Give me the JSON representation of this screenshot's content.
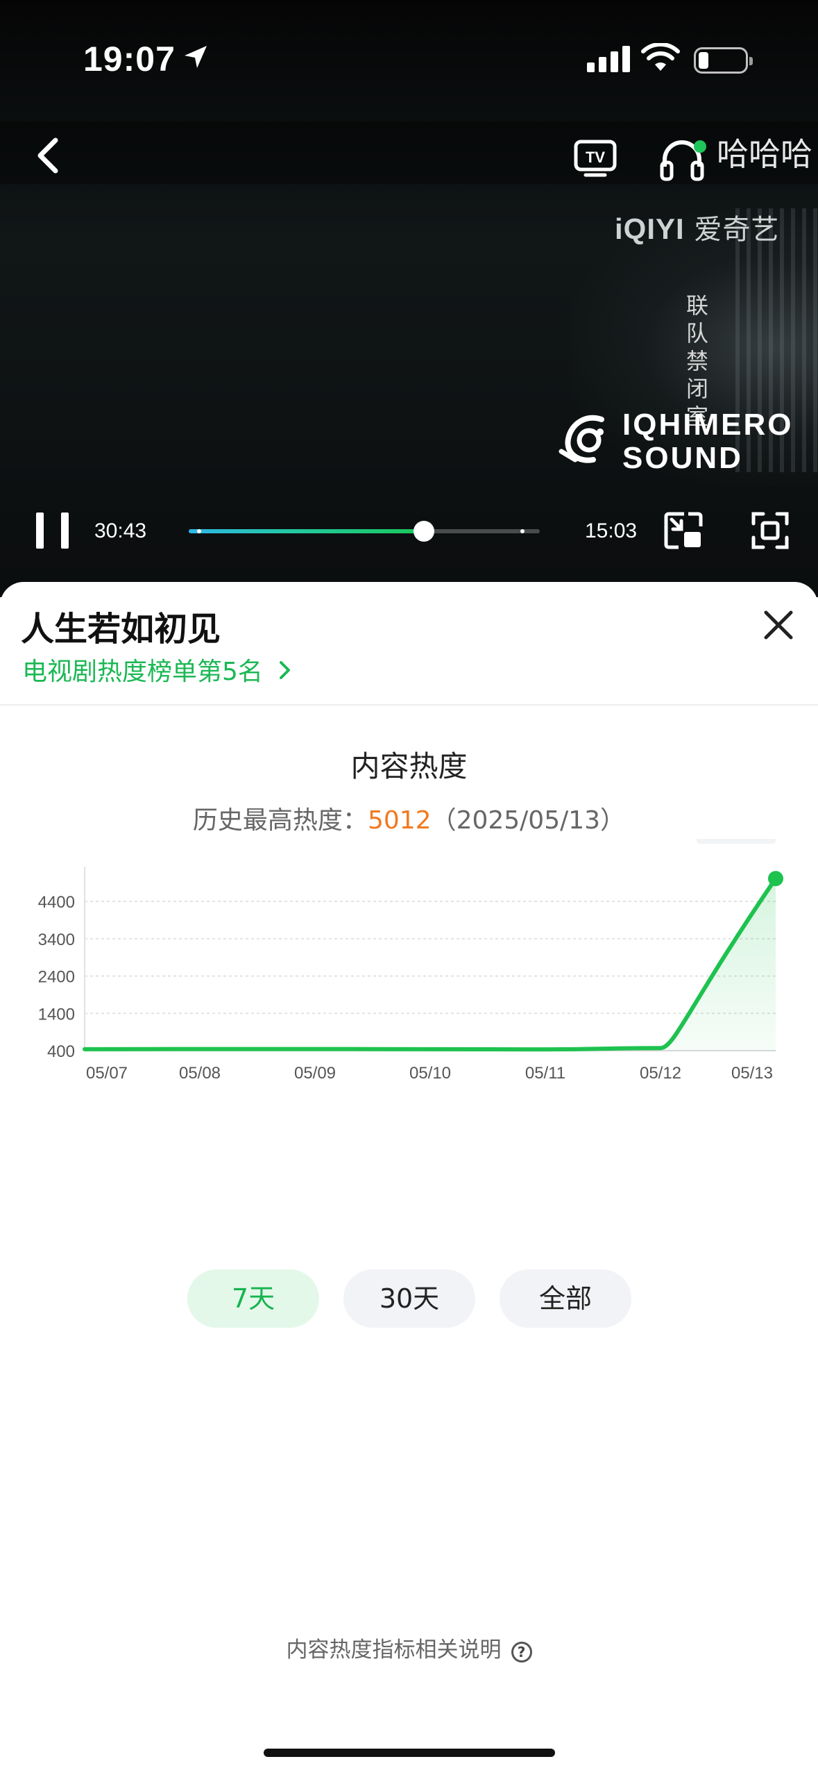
{
  "status_bar": {
    "time": "19:07",
    "icons": [
      "location-arrow-icon",
      "cellular-signal-icon",
      "wifi-icon",
      "battery-icon"
    ],
    "battery_level": 0.12
  },
  "video": {
    "top_controls": {
      "back_icon": "chevron-left-icon",
      "tv_icon": "tv-cast-icon",
      "tv_label": "TV",
      "audio_icon": "headphones-icon"
    },
    "danmu_username": "哈哈哈",
    "watermark": {
      "brand": "iQIYI",
      "name": "爱奇艺"
    },
    "title_overlay": [
      "联",
      "队",
      "禁",
      "闭",
      "室"
    ],
    "sound_logo": [
      "IQHIMERO",
      "SOUND"
    ],
    "player": {
      "current_time": "30:43",
      "remaining_time": "15:03",
      "progress": 0.67,
      "pause_icon": "pause-icon",
      "pip_icon": "picture-in-picture-icon",
      "fullscreen_icon": "fullscreen-icon"
    }
  },
  "sheet": {
    "title": "人生若如初见",
    "rank_text": "电视剧热度榜单第5名",
    "close_icon": "close-icon",
    "section_title": "内容热度",
    "peak_label": "历史最高热度：",
    "peak_value": "5012",
    "peak_date": "（2025/05/13）",
    "tabs": [
      "7天",
      "30天",
      "全部"
    ],
    "active_tab": 0,
    "footer_text": "内容热度指标相关说明",
    "footer_icon": "question-circle-icon",
    "accent_color": "#1bb854",
    "highlight_color": "#f07a21"
  },
  "chart_data": {
    "type": "area",
    "title": "",
    "xlabel": "",
    "ylabel": "",
    "categories": [
      "05/07",
      "05/08",
      "05/09",
      "05/10",
      "05/11",
      "05/12",
      "05/13"
    ],
    "series": [
      {
        "values": [
          440,
          445,
          445,
          440,
          435,
          470,
          5012
        ]
      }
    ],
    "yticks": [
      400,
      1400,
      2400,
      3400,
      4400
    ],
    "ylim": [
      400,
      5012
    ],
    "grid": true,
    "tooltip": {
      "value": "5012",
      "date": "05/13"
    },
    "line_color": "#1ec24f"
  }
}
